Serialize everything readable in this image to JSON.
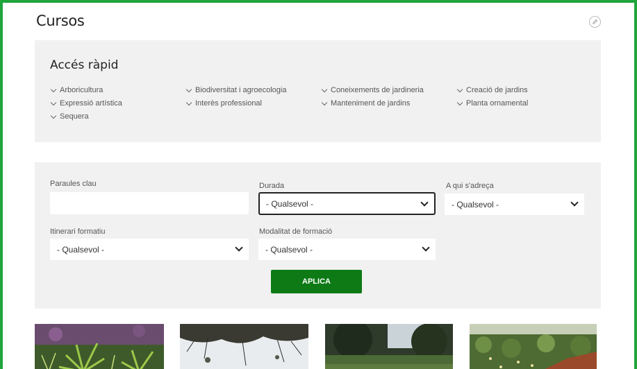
{
  "header": {
    "title": "Cursos",
    "edit_icon": "pencil-icon"
  },
  "quick_access": {
    "title": "Accés ràpid",
    "links": [
      "Arboricultura",
      "Biodiversitat i agroecologia",
      "Coneixements de jardineria",
      "Creació de jardins",
      "Expressió artística",
      "Interès professional",
      "Manteniment de jardins",
      "Planta ornamental",
      "Sequera"
    ]
  },
  "filters": {
    "keywords": {
      "label": "Paraules clau",
      "value": "",
      "placeholder": ""
    },
    "duration": {
      "label": "Durada",
      "selected": "- Qualsevol -"
    },
    "audience": {
      "label": "A qui s'adreça",
      "selected": "- Qualsevol -"
    },
    "itinerary": {
      "label": "Itinerari formatiu",
      "selected": "- Qualsevol -"
    },
    "modality": {
      "label": "Modalitat de formació",
      "selected": "- Qualsevol -"
    },
    "apply_label": "APLICA"
  },
  "cards": [
    {
      "image": "succulent-plants-image"
    },
    {
      "image": "pine-branches-image"
    },
    {
      "image": "garden-trees-image"
    },
    {
      "image": "flower-garden-image"
    }
  ],
  "colors": {
    "frame": "#1fa53a",
    "button": "#0d7a16",
    "panel": "#f1f1f1"
  }
}
